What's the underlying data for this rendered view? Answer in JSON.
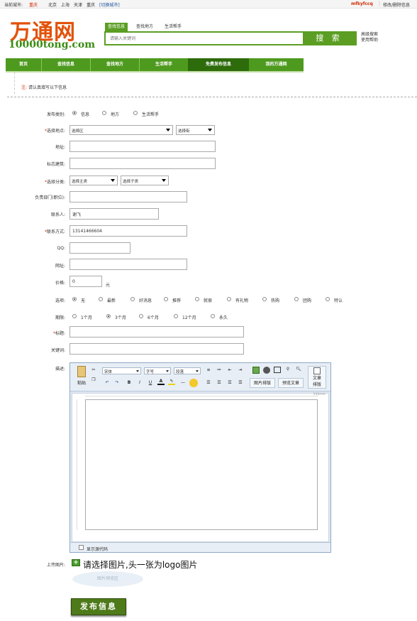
{
  "topbar": {
    "city_label": "当前城市:",
    "current_city": "重庆",
    "cities": [
      "北京",
      "上海",
      "天津",
      "重庆"
    ],
    "switch_city": "[切换城市]",
    "username": "mfkyfccq",
    "account_links": "修改/删除信息"
  },
  "logo": {
    "cn": "万通网",
    "en": "10000tong.com"
  },
  "search": {
    "tabs": [
      "查找信息",
      "查找地方",
      "生活帮手"
    ],
    "placeholder": "请输入关键词",
    "button": "搜 索",
    "advanced": "高级搜索",
    "help": "使用帮助"
  },
  "nav": {
    "items": [
      "首页",
      "查找信息",
      "查找地方",
      "生活帮手",
      "免费发布信息",
      "我的万通网"
    ],
    "active_index": 4
  },
  "notice": {
    "prefix": "注:",
    "text": "请认真填写以下信息"
  },
  "form": {
    "category": {
      "label": "发布类别:",
      "options": [
        "信息",
        "地方",
        "生活帮手"
      ],
      "selected": 0
    },
    "location": {
      "label": "选择地点:",
      "district": "选择区",
      "street": "选择街"
    },
    "address": {
      "label": "地址:",
      "value": ""
    },
    "landmark": {
      "label": "标志建筑:",
      "value": ""
    },
    "classify": {
      "label": "选择分类:",
      "main": "选择主类",
      "sub": "选择子类"
    },
    "job_title": {
      "label": "负责部门(职位):",
      "value": ""
    },
    "contact": {
      "label": "联系人:",
      "value": "谢飞"
    },
    "phone": {
      "label": "联系方式:",
      "value": "13141466604"
    },
    "qq": {
      "label": "QQ:",
      "value": ""
    },
    "website": {
      "label": "网址:",
      "value": ""
    },
    "price": {
      "label": "价格:",
      "value": "0",
      "unit": "元"
    },
    "options": {
      "label": "选项:",
      "items": [
        "无",
        "最新",
        "好消息",
        "推荐",
        "就很",
        "有礼物",
        "热购",
        "团购",
        "特认"
      ],
      "selected": 0
    },
    "period": {
      "label": "期限:",
      "items": [
        "1个月",
        "3个月",
        "6个月",
        "12个月",
        "永久"
      ],
      "selected": 1
    },
    "title": {
      "label": "标题:",
      "value": ""
    },
    "keywords": {
      "label": "关键词:",
      "value": ""
    },
    "description": {
      "label": "描述:"
    },
    "upload": {
      "label": "上传图片:",
      "text": "请选择图片,头一张为logo图片",
      "ghost": "图片预览区"
    },
    "submit": "发布信息"
  },
  "editor": {
    "paste": "粘贴",
    "font": "宋体",
    "size": "字号",
    "paragraph": "段落",
    "image_layout": "图片排版",
    "preview": "预览文章",
    "article_layout_1": "文章",
    "article_layout_2": "排版",
    "ruler_mark": "550mm",
    "show_source": "显示源代码"
  }
}
